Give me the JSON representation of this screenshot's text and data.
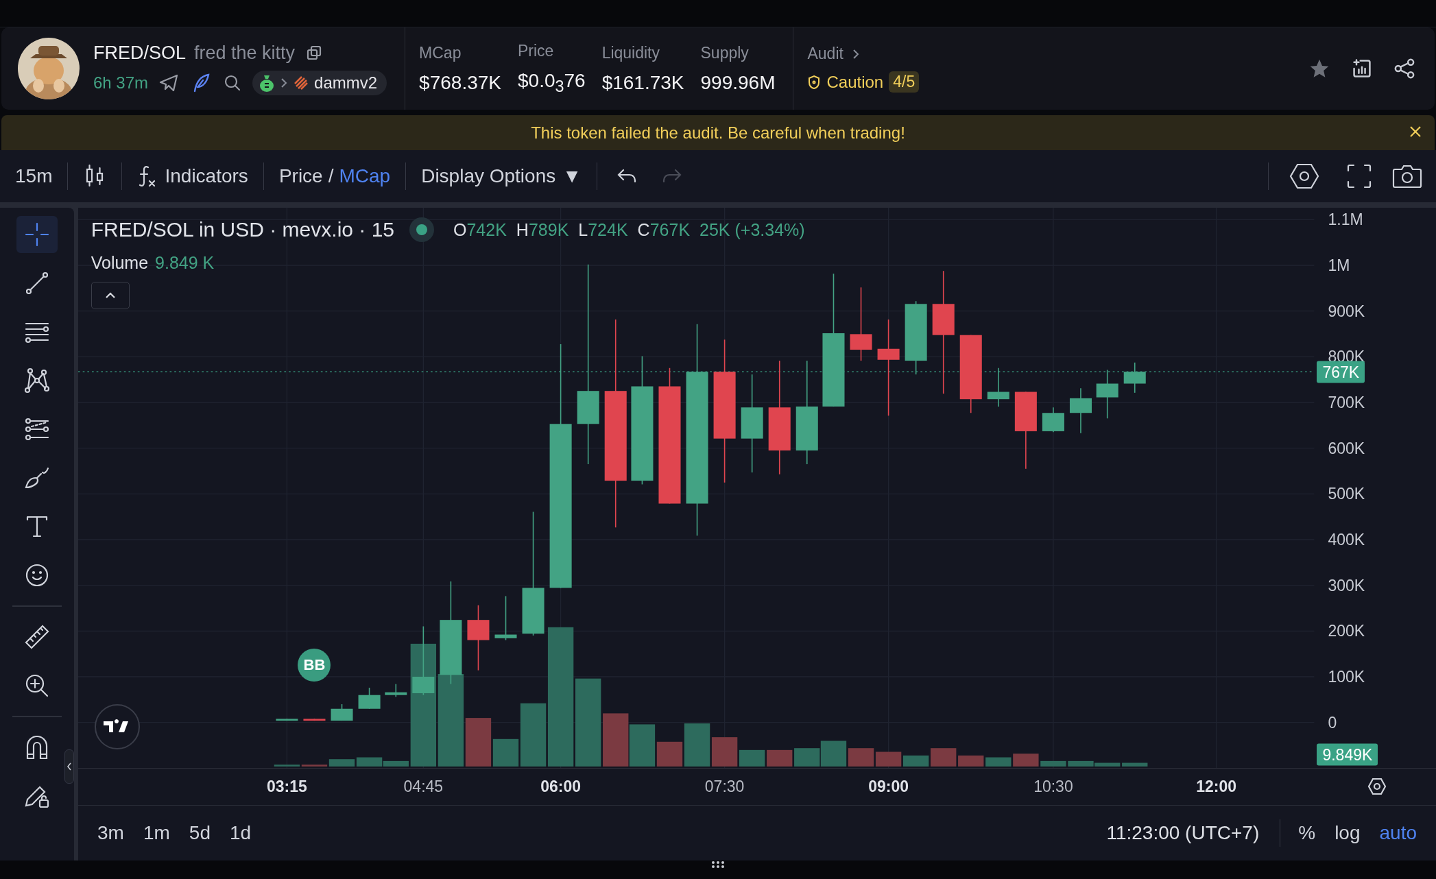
{
  "token": {
    "pair": "FRED/SOL",
    "name": "fred the kitty",
    "age": "6h 37m",
    "dex": "dammv2"
  },
  "stats": [
    {
      "label": "MCap",
      "value": "$768.37K"
    },
    {
      "label": "Price",
      "value": "$0.0$_{3}$76"
    },
    {
      "label": "Liquidity",
      "value": "$161.73K"
    },
    {
      "label": "Supply",
      "value": "999.96M"
    }
  ],
  "audit": {
    "label": "Audit",
    "status": "Caution",
    "score": "4/5"
  },
  "banner": {
    "text": "This token failed the audit. Be careful when trading!"
  },
  "toolbar": {
    "interval": "15m",
    "indicators": "Indicators",
    "unit_toggle": [
      {
        "label": "Price",
        "selected": false
      },
      {
        "label": "MCap",
        "selected": true
      }
    ],
    "separator": "/",
    "display_options": "Display Options",
    "display_caret": "▼",
    "redo_disabled": true
  },
  "tools": [
    {
      "kind": "crosshair",
      "selected": true
    },
    {
      "kind": "trendline",
      "selected": false
    },
    {
      "kind": "hlines",
      "selected": false
    },
    {
      "kind": "pattern",
      "selected": false
    },
    {
      "kind": "fib",
      "selected": false
    },
    {
      "kind": "brush",
      "selected": false
    },
    {
      "kind": "text",
      "selected": false
    },
    {
      "kind": "emoji",
      "selected": false
    },
    {
      "kind": "ruler",
      "selected": false
    },
    {
      "kind": "zoom",
      "selected": false
    },
    {
      "kind": "magnet",
      "selected": false
    },
    {
      "kind": "lock",
      "selected": false
    }
  ],
  "legend": {
    "title": "FRED/SOL in USD · mevx.io · 15",
    "ohlc": [
      {
        "key": "O",
        "value": "742K"
      },
      {
        "key": "H",
        "value": "789K"
      },
      {
        "key": "L",
        "value": "724K"
      },
      {
        "key": "C",
        "value": "767K"
      }
    ],
    "change": "25K (+3.34%)",
    "volume_label": "Volume",
    "volume_value": "9.849 K"
  },
  "y_axis": [
    "1.1M",
    "1M",
    "900K",
    "800K",
    "700K",
    "600K",
    "500K",
    "400K",
    "300K",
    "200K",
    "100K",
    "0"
  ],
  "price_tag": "767K",
  "volume_tag": "9.849K",
  "marker": "BB",
  "x_axis": [
    {
      "label": "03:15",
      "bold": true
    },
    {
      "label": "04:45",
      "bold": false
    },
    {
      "label": "06:00",
      "bold": true
    },
    {
      "label": "07:30",
      "bold": false
    },
    {
      "label": "09:00",
      "bold": true
    },
    {
      "label": "10:30",
      "bold": false
    },
    {
      "label": "12:00",
      "bold": true
    }
  ],
  "ranges": [
    "3m",
    "1m",
    "5d",
    "1d"
  ],
  "clock": "11:23:00 (UTC+7)",
  "scale_toggles": [
    {
      "label": "%",
      "selected": false
    },
    {
      "label": "log",
      "selected": false
    },
    {
      "label": "auto",
      "selected": true
    }
  ]
}
